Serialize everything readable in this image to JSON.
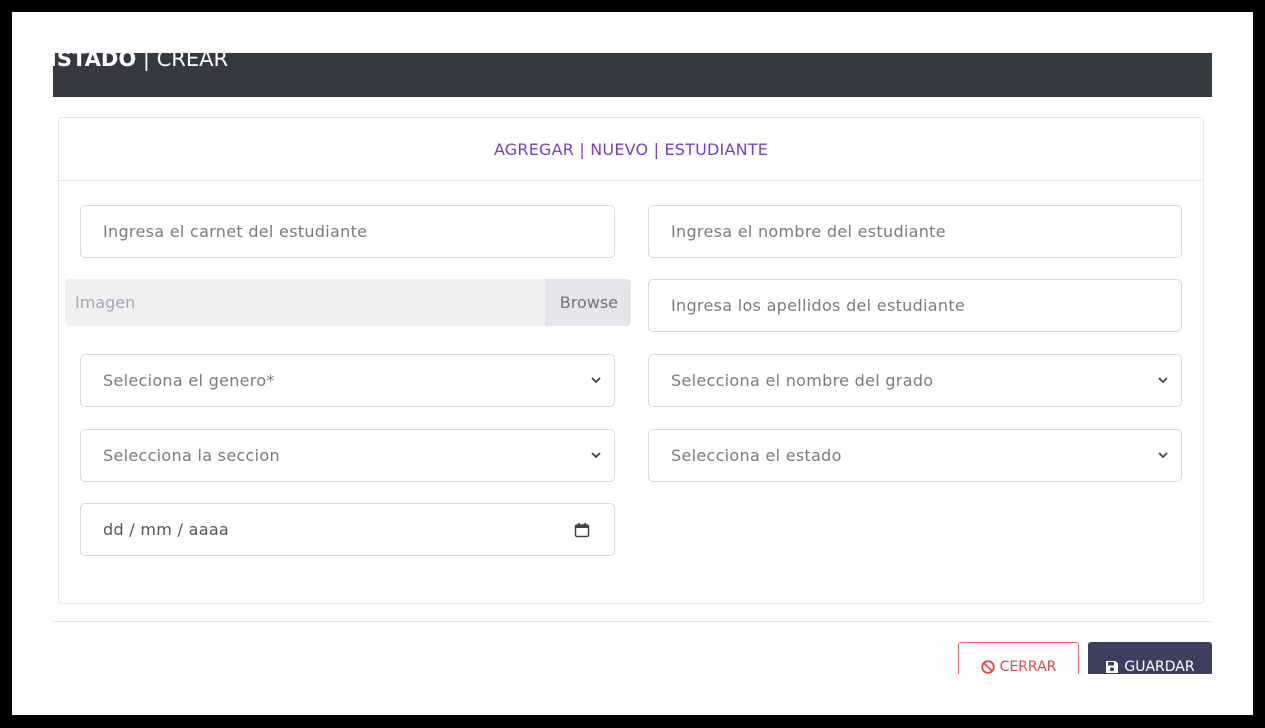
{
  "header": {
    "title_bold": "ISTADO",
    "title_separator": " | ",
    "title_light": "CREAR"
  },
  "card": {
    "title": "AGREGAR | NUEVO | ESTUDIANTE"
  },
  "form": {
    "carnet_placeholder": "Ingresa el carnet del estudiante",
    "nombre_placeholder": "Ingresa el nombre del estudiante",
    "imagen_placeholder": "Imagen",
    "browse_label": "Browse",
    "apellidos_placeholder": "Ingresa los apellidos del estudiante",
    "genero_placeholder": "Seleciona el genero*",
    "grado_placeholder": "Selecciona el nombre del grado",
    "seccion_placeholder": "Selecciona la seccion",
    "estado_placeholder": "Selecciona el estado",
    "fecha_placeholder": "dd / mm / aaaa",
    "calendar_icon": "calendar-icon",
    "select_icon": "chevron-down-icon"
  },
  "footer": {
    "close_label": "CERRAR",
    "close_icon": "ban-icon",
    "save_label": "GUARDAR",
    "save_icon": "floppy-disk-icon"
  },
  "colors": {
    "header_bg": "#363a40",
    "accent_purple": "#7a3fc4",
    "close_red": "#e24a4a",
    "save_bg": "#3d3f5e"
  }
}
